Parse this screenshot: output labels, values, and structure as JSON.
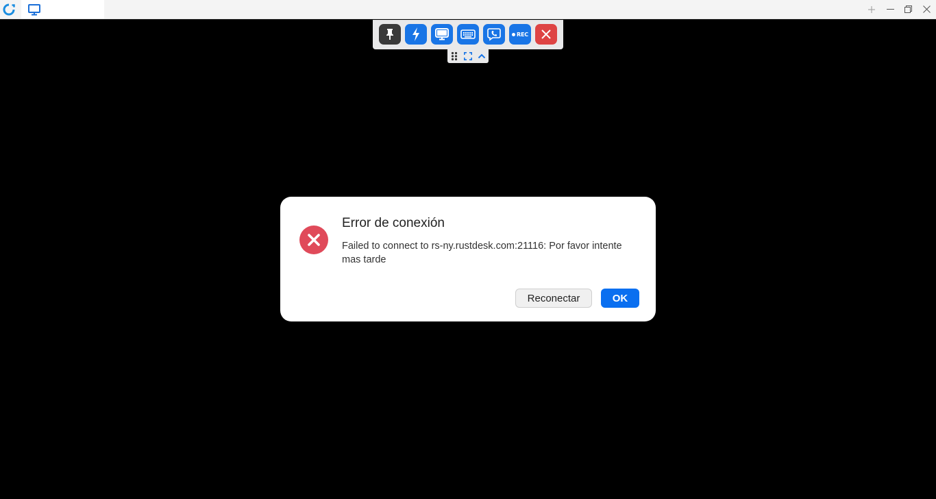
{
  "titlebar": {
    "app_icon": "rustdesk-logo-icon",
    "tab_icon": "monitor-icon",
    "window_controls": [
      "add-tab-icon",
      "minimize-icon",
      "restore-icon",
      "close-icon"
    ]
  },
  "toolbar": {
    "buttons": [
      {
        "name": "pin-icon",
        "style": "dark"
      },
      {
        "name": "lightning-icon",
        "style": "blue"
      },
      {
        "name": "display-icon",
        "style": "blue"
      },
      {
        "name": "keyboard-icon",
        "style": "blue"
      },
      {
        "name": "chat-icon",
        "style": "blue"
      },
      {
        "name": "record-icon",
        "style": "blue",
        "label": "REC"
      },
      {
        "name": "close-session-icon",
        "style": "red"
      }
    ],
    "sub_icons": [
      "drag-handle-icon",
      "fullscreen-icon",
      "collapse-chevron-icon"
    ]
  },
  "dialog": {
    "title": "Error de conexión",
    "message": "Failed to connect to rs-ny.rustdesk.com:21116: Por favor intente mas tarde",
    "reconnect_label": "Reconectar",
    "ok_label": "OK",
    "icon": "error-circle-icon"
  },
  "colors": {
    "accent": "#1975e6",
    "ok_button": "#0a6ff0",
    "error": "#e04a5a",
    "close_red": "#de4444"
  }
}
